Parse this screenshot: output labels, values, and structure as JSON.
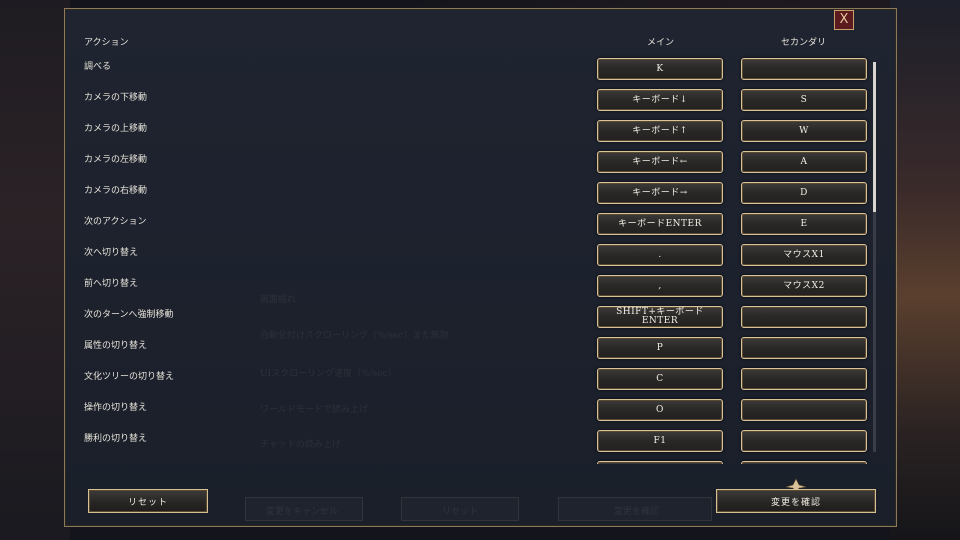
{
  "dialog": {
    "close_label": "X",
    "header_action": "アクション",
    "header_main": "メイン",
    "header_secondary": "セカンダリ",
    "reset_label": "リセット",
    "confirm_label": "変更を確認"
  },
  "rows": [
    {
      "action": "調べる",
      "main": "K",
      "secondary": ""
    },
    {
      "action": "カメラの下移動",
      "main": "キーボード↓",
      "secondary": "S"
    },
    {
      "action": "カメラの上移動",
      "main": "キーボード↑",
      "secondary": "W"
    },
    {
      "action": "カメラの左移動",
      "main": "キーボード←",
      "secondary": "A"
    },
    {
      "action": "カメラの右移動",
      "main": "キーボード→",
      "secondary": "D"
    },
    {
      "action": "次のアクション",
      "main": "キーボードENTER",
      "secondary": "E"
    },
    {
      "action": "次へ切り替え",
      "main": ".",
      "secondary": "マウスX1"
    },
    {
      "action": "前へ切り替え",
      "main": ",",
      "secondary": "マウスX2"
    },
    {
      "action": "次のターンへ強制移動",
      "main": "SHIFT+キーボード\nENTER",
      "secondary": ""
    },
    {
      "action": "属性の切り替え",
      "main": "P",
      "secondary": ""
    },
    {
      "action": "文化ツリーの切り替え",
      "main": "C",
      "secondary": ""
    },
    {
      "action": "操作の切り替え",
      "main": "O",
      "secondary": ""
    },
    {
      "action": "勝利の切り替え",
      "main": "F1",
      "secondary": ""
    },
    {
      "action": "",
      "main": "",
      "secondary": ""
    }
  ],
  "background": {
    "ghost_texts": [
      "画面揺れ",
      "自動化付けスクローリング（%/sec）また無効",
      "UIスクローリング速度（%/sec）",
      "ワールドモードで読み上げ",
      "チャットの読み上げ"
    ],
    "ghost_buttons": [
      "変更をキャンセル",
      "リセット",
      "変更を確認"
    ]
  },
  "colors": {
    "accent_gold": "#d9c39a",
    "close_red": "#5a1a1e",
    "panel_bg": "#1d222d",
    "text": "#e8e4da"
  },
  "icons": {
    "close": "close-icon",
    "confirm_ornament": "ornament-icon"
  }
}
